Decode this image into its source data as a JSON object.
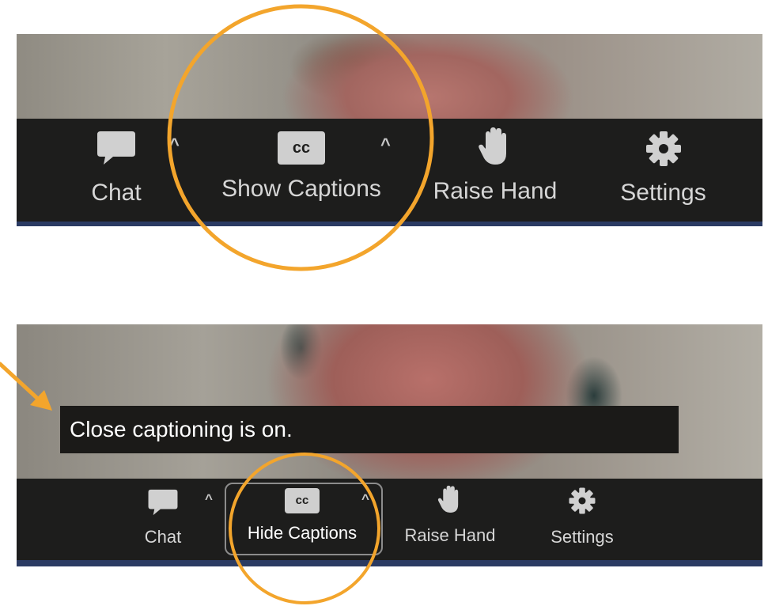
{
  "accent_color": "#f3a52c",
  "top_toolbar": {
    "items": [
      {
        "label": "Chat",
        "icon": "chat-icon"
      },
      {
        "label": "Show Captions",
        "icon": "cc-icon",
        "icon_text": "cc"
      },
      {
        "label": "Raise Hand",
        "icon": "hand-icon"
      },
      {
        "label": "Settings",
        "icon": "gear-icon"
      }
    ],
    "caret": "^"
  },
  "bottom_toolbar": {
    "caption_text": "Close captioning is on.",
    "items": [
      {
        "label": "Chat",
        "icon": "chat-icon"
      },
      {
        "label": "Hide Captions",
        "icon": "cc-icon",
        "icon_text": "cc",
        "active": true
      },
      {
        "label": "Raise Hand",
        "icon": "hand-icon"
      },
      {
        "label": "Settings",
        "icon": "gear-icon"
      }
    ],
    "caret": "^"
  }
}
